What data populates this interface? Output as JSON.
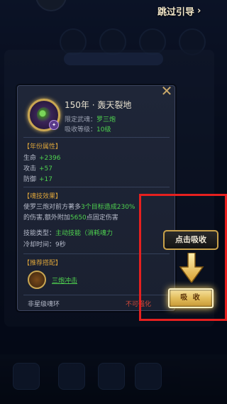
{
  "header": {
    "skip_label": "跳过引导"
  },
  "item": {
    "name": "150年 · 轰天裂地",
    "designated_label": "限定武魂：",
    "designated_value": "罗三炮",
    "level_label": "吸收等级：",
    "level_value": "10级"
  },
  "attributes": {
    "title": "【年份属性】",
    "stats": [
      {
        "label": "生命",
        "value": "+2396"
      },
      {
        "label": "攻击",
        "value": "+57"
      },
      {
        "label": "防御",
        "value": "+17"
      }
    ]
  },
  "skill": {
    "title": "【魂技效果】",
    "line1_a": "使罗三炮对前方著多",
    "line1_b": "3个目标造成",
    "line1_c": "230%",
    "line2_a": "的伤害,额外附加",
    "line2_b": "5650",
    "line2_c": "点固定伤害",
    "type_label": "技能类型：",
    "type_value": "主动技能（消耗魂力",
    "cooldown_label": "冷却时间：",
    "cooldown_value": "9秒"
  },
  "combo": {
    "title": "【推荐搭配】",
    "link_label": "三炮冲击"
  },
  "footer": {
    "left": "非星级魂环",
    "right": "不可强化"
  },
  "guide": {
    "hint_label": "点击吸收",
    "absorb_label": "吸 收"
  },
  "colors": {
    "accent_gold": "#c9a652",
    "value_green": "#4fd24f",
    "warn_red": "#d24a3a",
    "highlight_red": "#e6201f"
  }
}
